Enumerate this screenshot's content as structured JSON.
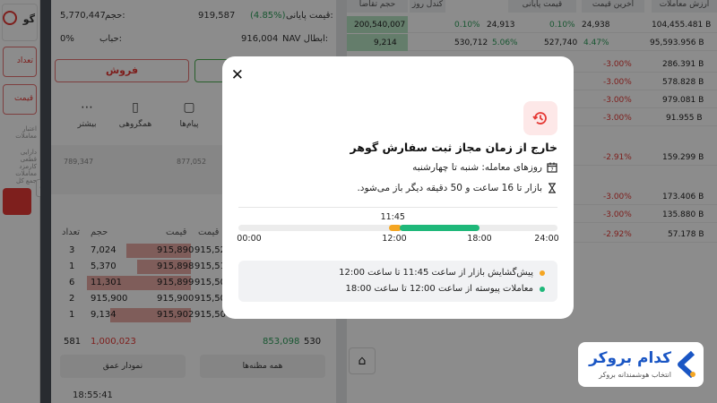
{
  "modal": {
    "title": "خارج از زمان مجاز ثبت سفارش گوهر",
    "trading_days": "روزهای معامله: شنبه تا چهارشنبه",
    "market_status": "بازار تا 16 ساعت و 50 دقیقه دیگر باز می‌شود.",
    "timeline": {
      "start_label": "00:00",
      "end_label": "24:00",
      "preopen_label": "11:45",
      "open_label": "12:00",
      "close_label": "18:00",
      "range_hours": [
        0,
        24
      ],
      "preopen_hours": [
        11.75,
        12
      ],
      "continuous_hours": [
        12,
        18
      ]
    },
    "legend": [
      {
        "text": "پیش‌گشایش بازار از ساعت 11:45 تا ساعت 12:00",
        "color": "#f5a623"
      },
      {
        "text": "معاملات پیوسته از ساعت 12:00 تا ساعت 18:00",
        "color": "#1fb87a"
      }
    ],
    "close_icon": "close-icon"
  },
  "brand": {
    "name": "کدام بروکر",
    "tagline": "انتخاب هوشمندانه بروکر"
  },
  "background": {
    "volume_label": "حجم:",
    "volume_value": "5,770,447",
    "final_price_label": "قیمت پایانی:",
    "final_price_pct": "(4.85%)",
    "final_price_value": "919,587",
    "bubble_label": "حباب:",
    "bubble_value": "0%",
    "nav_label": "NAV ابطال:",
    "nav_value": "916,004",
    "sell_label": "فروش",
    "tools": [
      "بیشتر",
      "همگروهی",
      "پیام‌ها"
    ],
    "chart_values": [
      "789,347",
      "877,052"
    ],
    "orderbook_headers": [
      "تعداد",
      "حجم",
      "قیمت",
      "قیمت"
    ],
    "orderbook": [
      {
        "count": "3",
        "volume": "7,024",
        "price": "915,890",
        "buy": "915,52"
      },
      {
        "count": "1",
        "volume": "5,370",
        "price": "915,898",
        "buy": "915,51"
      },
      {
        "count": "6",
        "volume": "11,301",
        "price": "915,899",
        "buy": "915,50"
      },
      {
        "count": "2",
        "volume": "915,900",
        "price": "915,900",
        "buy": "915,50"
      },
      {
        "count": "1",
        "volume": "9,134",
        "price": "915,902",
        "buy": "915,50"
      }
    ],
    "sum_left": "581",
    "sum_red": "1,000,023",
    "sum_green": "853,098",
    "sum_right": "530",
    "depth_chart_label": "نمودار عمق",
    "all_orders_label": "همه مظنه‌ها",
    "footer_time": "18:55:41",
    "right_headers": [
      "ارزش معاملات",
      "آخرین قیمت",
      "قیمت پایانی",
      "کندل روز",
      "حجم تقاضا"
    ],
    "right_rows": [
      {
        "value": "95,593.956 B",
        "last": "527,740",
        "last_pct": "4.47%",
        "final": "530,712",
        "final_pct": "5.06%",
        "demand": "9,214"
      },
      {
        "value": "286.391 B",
        "last_pct": "-3.00%"
      },
      {
        "value": "578.828 B",
        "last_pct": "-3.00%"
      },
      {
        "value": "979.081 B",
        "last_pct": "-3.00%"
      },
      {
        "value": "91.955 B",
        "last_pct": "-3.00%"
      },
      {
        "value": "159.299 B",
        "last_pct": "-2.91%"
      },
      {
        "value": "173.406 B",
        "last_pct": "-3.00%"
      },
      {
        "value": "135.880 B",
        "last_pct": "-3.00%"
      },
      {
        "value": "57.178 B",
        "last_pct": "-2.92%"
      }
    ],
    "top_row": {
      "value": "104,455.481 B",
      "last": "24,938",
      "last_pct": "0.10%",
      "final": "24,913",
      "final_pct": "0.10%",
      "demand": "200,540,007"
    }
  }
}
